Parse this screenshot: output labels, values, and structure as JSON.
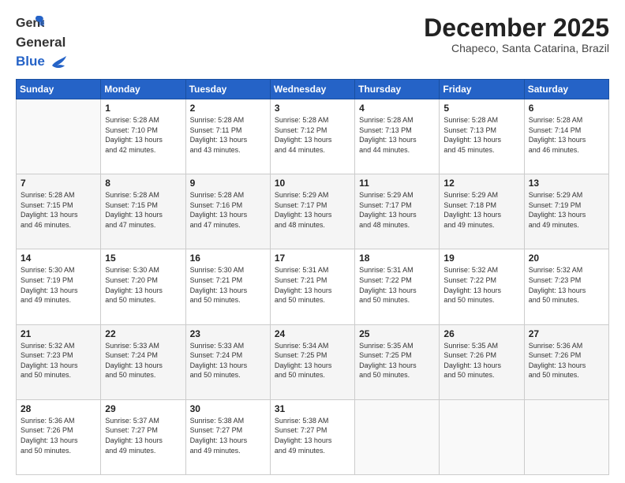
{
  "header": {
    "logo": {
      "general": "General",
      "blue": "Blue"
    },
    "title": "December 2025",
    "location": "Chapeco, Santa Catarina, Brazil"
  },
  "calendar": {
    "days_of_week": [
      "Sunday",
      "Monday",
      "Tuesday",
      "Wednesday",
      "Thursday",
      "Friday",
      "Saturday"
    ],
    "weeks": [
      [
        {
          "day": "",
          "info": ""
        },
        {
          "day": "1",
          "info": "Sunrise: 5:28 AM\nSunset: 7:10 PM\nDaylight: 13 hours\nand 42 minutes."
        },
        {
          "day": "2",
          "info": "Sunrise: 5:28 AM\nSunset: 7:11 PM\nDaylight: 13 hours\nand 43 minutes."
        },
        {
          "day": "3",
          "info": "Sunrise: 5:28 AM\nSunset: 7:12 PM\nDaylight: 13 hours\nand 44 minutes."
        },
        {
          "day": "4",
          "info": "Sunrise: 5:28 AM\nSunset: 7:13 PM\nDaylight: 13 hours\nand 44 minutes."
        },
        {
          "day": "5",
          "info": "Sunrise: 5:28 AM\nSunset: 7:13 PM\nDaylight: 13 hours\nand 45 minutes."
        },
        {
          "day": "6",
          "info": "Sunrise: 5:28 AM\nSunset: 7:14 PM\nDaylight: 13 hours\nand 46 minutes."
        }
      ],
      [
        {
          "day": "7",
          "info": "Sunrise: 5:28 AM\nSunset: 7:15 PM\nDaylight: 13 hours\nand 46 minutes."
        },
        {
          "day": "8",
          "info": "Sunrise: 5:28 AM\nSunset: 7:15 PM\nDaylight: 13 hours\nand 47 minutes."
        },
        {
          "day": "9",
          "info": "Sunrise: 5:28 AM\nSunset: 7:16 PM\nDaylight: 13 hours\nand 47 minutes."
        },
        {
          "day": "10",
          "info": "Sunrise: 5:29 AM\nSunset: 7:17 PM\nDaylight: 13 hours\nand 48 minutes."
        },
        {
          "day": "11",
          "info": "Sunrise: 5:29 AM\nSunset: 7:17 PM\nDaylight: 13 hours\nand 48 minutes."
        },
        {
          "day": "12",
          "info": "Sunrise: 5:29 AM\nSunset: 7:18 PM\nDaylight: 13 hours\nand 49 minutes."
        },
        {
          "day": "13",
          "info": "Sunrise: 5:29 AM\nSunset: 7:19 PM\nDaylight: 13 hours\nand 49 minutes."
        }
      ],
      [
        {
          "day": "14",
          "info": "Sunrise: 5:30 AM\nSunset: 7:19 PM\nDaylight: 13 hours\nand 49 minutes."
        },
        {
          "day": "15",
          "info": "Sunrise: 5:30 AM\nSunset: 7:20 PM\nDaylight: 13 hours\nand 50 minutes."
        },
        {
          "day": "16",
          "info": "Sunrise: 5:30 AM\nSunset: 7:21 PM\nDaylight: 13 hours\nand 50 minutes."
        },
        {
          "day": "17",
          "info": "Sunrise: 5:31 AM\nSunset: 7:21 PM\nDaylight: 13 hours\nand 50 minutes."
        },
        {
          "day": "18",
          "info": "Sunrise: 5:31 AM\nSunset: 7:22 PM\nDaylight: 13 hours\nand 50 minutes."
        },
        {
          "day": "19",
          "info": "Sunrise: 5:32 AM\nSunset: 7:22 PM\nDaylight: 13 hours\nand 50 minutes."
        },
        {
          "day": "20",
          "info": "Sunrise: 5:32 AM\nSunset: 7:23 PM\nDaylight: 13 hours\nand 50 minutes."
        }
      ],
      [
        {
          "day": "21",
          "info": "Sunrise: 5:32 AM\nSunset: 7:23 PM\nDaylight: 13 hours\nand 50 minutes."
        },
        {
          "day": "22",
          "info": "Sunrise: 5:33 AM\nSunset: 7:24 PM\nDaylight: 13 hours\nand 50 minutes."
        },
        {
          "day": "23",
          "info": "Sunrise: 5:33 AM\nSunset: 7:24 PM\nDaylight: 13 hours\nand 50 minutes."
        },
        {
          "day": "24",
          "info": "Sunrise: 5:34 AM\nSunset: 7:25 PM\nDaylight: 13 hours\nand 50 minutes."
        },
        {
          "day": "25",
          "info": "Sunrise: 5:35 AM\nSunset: 7:25 PM\nDaylight: 13 hours\nand 50 minutes."
        },
        {
          "day": "26",
          "info": "Sunrise: 5:35 AM\nSunset: 7:26 PM\nDaylight: 13 hours\nand 50 minutes."
        },
        {
          "day": "27",
          "info": "Sunrise: 5:36 AM\nSunset: 7:26 PM\nDaylight: 13 hours\nand 50 minutes."
        }
      ],
      [
        {
          "day": "28",
          "info": "Sunrise: 5:36 AM\nSunset: 7:26 PM\nDaylight: 13 hours\nand 50 minutes."
        },
        {
          "day": "29",
          "info": "Sunrise: 5:37 AM\nSunset: 7:27 PM\nDaylight: 13 hours\nand 49 minutes."
        },
        {
          "day": "30",
          "info": "Sunrise: 5:38 AM\nSunset: 7:27 PM\nDaylight: 13 hours\nand 49 minutes."
        },
        {
          "day": "31",
          "info": "Sunrise: 5:38 AM\nSunset: 7:27 PM\nDaylight: 13 hours\nand 49 minutes."
        },
        {
          "day": "",
          "info": ""
        },
        {
          "day": "",
          "info": ""
        },
        {
          "day": "",
          "info": ""
        }
      ]
    ]
  }
}
